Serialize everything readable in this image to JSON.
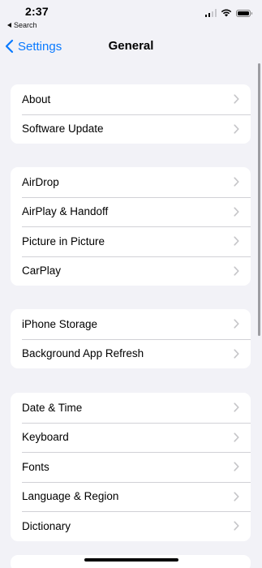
{
  "status_bar": {
    "time": "2:37",
    "back_app": "Search"
  },
  "nav": {
    "back_label": "Settings",
    "title": "General"
  },
  "groups": [
    {
      "items": [
        {
          "label": "About"
        },
        {
          "label": "Software Update"
        }
      ]
    },
    {
      "items": [
        {
          "label": "AirDrop"
        },
        {
          "label": "AirPlay & Handoff"
        },
        {
          "label": "Picture in Picture"
        },
        {
          "label": "CarPlay"
        }
      ]
    },
    {
      "items": [
        {
          "label": "iPhone Storage"
        },
        {
          "label": "Background App Refresh"
        }
      ]
    },
    {
      "items": [
        {
          "label": "Date & Time"
        },
        {
          "label": "Keyboard"
        },
        {
          "label": "Fonts"
        },
        {
          "label": "Language & Region"
        },
        {
          "label": "Dictionary"
        }
      ]
    }
  ],
  "colors": {
    "accent": "#0a7aff",
    "background": "#f2f2f7",
    "chevron": "#c4c4c7"
  },
  "icons": {
    "back": "chevron-left-icon",
    "row": "chevron-right-icon",
    "wifi": "wifi-icon",
    "battery": "battery-icon",
    "signal": "cellular-signal-icon"
  }
}
